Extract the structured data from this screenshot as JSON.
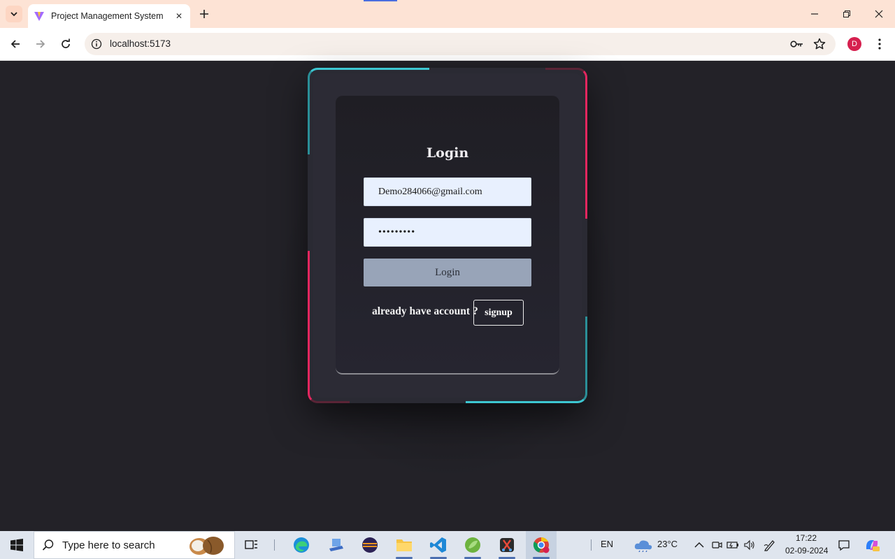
{
  "browser": {
    "tab_title": "Project Management System",
    "url": "localhost:5173",
    "profile_initial": "D"
  },
  "login": {
    "title": "Login",
    "email_value": "Demo284066@gmail.com",
    "password_value": "•••••••••",
    "login_button_label": "Login",
    "account_prompt": "already have account ?",
    "signup_label": "signup"
  },
  "taskbar": {
    "search_placeholder": "Type here to search",
    "language": "EN",
    "temperature": "23°C",
    "time": "17:22",
    "date": "02-09-2024"
  },
  "colors": {
    "page_bg": "#232228",
    "accent_cyan": "#3dc7d2",
    "accent_pink": "#e3265f",
    "input_bg": "#e8f0fe",
    "login_button_bg": "#98a4b8"
  }
}
